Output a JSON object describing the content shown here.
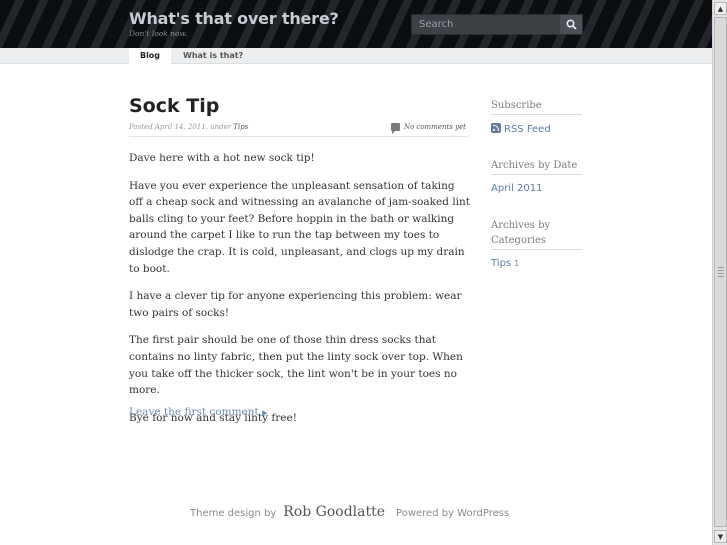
{
  "header": {
    "site_title": "What's that over there?",
    "tagline": "Don't look now.",
    "search_placeholder": "Search"
  },
  "nav": {
    "tabs": [
      {
        "label": "Blog",
        "active": true
      },
      {
        "label": "What is that?",
        "active": false
      }
    ]
  },
  "post": {
    "title": "Sock Tip",
    "meta_prefix": "Posted April 14, 2011, under",
    "category": "Tips",
    "comments": "No comments yet",
    "paragraphs": [
      "Dave here with a hot new sock tip!",
      "Have you ever experience the unpleasant sensation of taking off a cheap sock and witnessing an avalanche of jam-soaked lint balls cling to your feet?  Before hoppin in the bath or walking around the carpet I like to run the tap between my toes to dislodge the crap.  It is cold, unpleasant, and clogs up my drain to boot.",
      "I have a clever tip for anyone experiencing this problem: wear two pairs of socks!",
      "The first pair should be one of those thin dress socks that contains no linty fabric, then put the linty sock over top.  When you take off the thicker sock, the lint won't be in your toes no more.",
      "Bye for now and stay linty free!"
    ],
    "leave_comment": "Leave the first comment",
    "leave_comment_arrow": "▶"
  },
  "sidebar": {
    "subscribe": {
      "heading": "Subscribe",
      "link": "RSS Feed"
    },
    "archives_date": {
      "heading": "Archives by Date",
      "link": "April 2011"
    },
    "archives_categories": {
      "heading": "Archives by Categories",
      "link": "Tips",
      "count": "1"
    }
  },
  "footer": {
    "theme_prefix": "Theme design by",
    "designer": "Rob Goodlatte",
    "powered": "Powered by WordPress"
  },
  "icons": {
    "search": "magnifier-icon",
    "rss": "rss-icon",
    "comment": "speech-bubble-icon"
  },
  "colors": {
    "header_bg": "#0d0f12",
    "link": "#5b7ea6",
    "title": "#222222"
  }
}
